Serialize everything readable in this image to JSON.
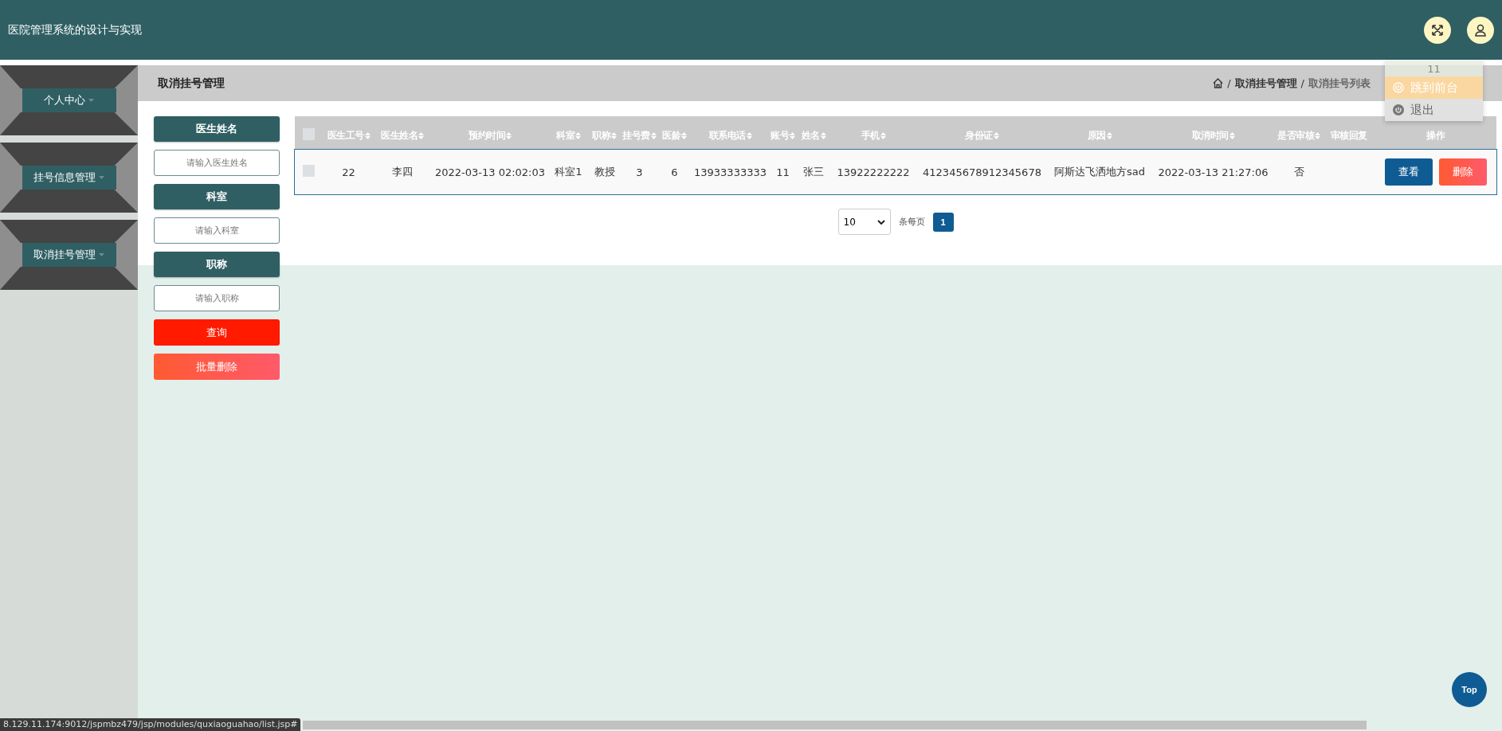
{
  "header": {
    "title": "医院管理系统的设计与实现"
  },
  "user_menu": {
    "username": "11",
    "items": [
      {
        "label": "跳到前台",
        "kind": "front",
        "selected": true
      },
      {
        "label": "退出",
        "kind": "logout",
        "selected": false
      }
    ]
  },
  "sidebar": {
    "items": [
      {
        "label": "个人中心"
      },
      {
        "label": "挂号信息管理"
      },
      {
        "label": "取消挂号管理"
      }
    ]
  },
  "page_title": "取消挂号管理",
  "breadcrumb": {
    "separator": "/",
    "items": [
      "取消挂号管理",
      "取消挂号列表"
    ]
  },
  "search": {
    "fields": [
      {
        "label": "医生姓名",
        "placeholder": "请输入医生姓名"
      },
      {
        "label": "科室",
        "placeholder": "请输入科室"
      },
      {
        "label": "职称",
        "placeholder": "请输入职称"
      }
    ],
    "buttons": [
      {
        "label": "查询",
        "kind": "search"
      },
      {
        "label": "批量删除",
        "kind": "batch-delete"
      }
    ]
  },
  "table": {
    "all_checked": false,
    "columns": [
      {
        "label": "医生工号",
        "sortable": true
      },
      {
        "label": "医生姓名",
        "sortable": true
      },
      {
        "label": "预约时间",
        "sortable": true
      },
      {
        "label": "科室",
        "sortable": true
      },
      {
        "label": "职称",
        "sortable": true
      },
      {
        "label": "挂号费",
        "sortable": true
      },
      {
        "label": "医龄",
        "sortable": true
      },
      {
        "label": "联系电话",
        "sortable": true
      },
      {
        "label": "账号",
        "sortable": true
      },
      {
        "label": "姓名",
        "sortable": true
      },
      {
        "label": "手机",
        "sortable": true
      },
      {
        "label": "身份证",
        "sortable": true
      },
      {
        "label": "原因",
        "sortable": true
      },
      {
        "label": "取消时间",
        "sortable": true
      },
      {
        "label": "是否审核",
        "sortable": true
      },
      {
        "label": "审核回复",
        "sortable": false
      },
      {
        "label": "操作",
        "sortable": false
      }
    ],
    "rows": [
      {
        "checked": false,
        "cells": [
          "22",
          "李四",
          "2022-03-13 02:02:03",
          "科室1",
          "教授",
          "3",
          "6",
          "13933333333",
          "11",
          "张三",
          "13922222222",
          "412345678912345678",
          "阿斯达飞洒地方sad",
          "2022-03-13 21:27:06",
          "否",
          ""
        ],
        "actions": [
          {
            "label": "查看",
            "kind": "view"
          },
          {
            "label": "删除",
            "kind": "delete"
          }
        ]
      }
    ]
  },
  "pagination": {
    "page_size": "10",
    "page_size_label": "条每页",
    "pages": [
      {
        "label": "1",
        "selected": true
      }
    ]
  },
  "top_button": "Top",
  "status_url": "8.129.11.174:9012/jspmbz479/jsp/modules/quxiaoguahao/list.jsp#"
}
